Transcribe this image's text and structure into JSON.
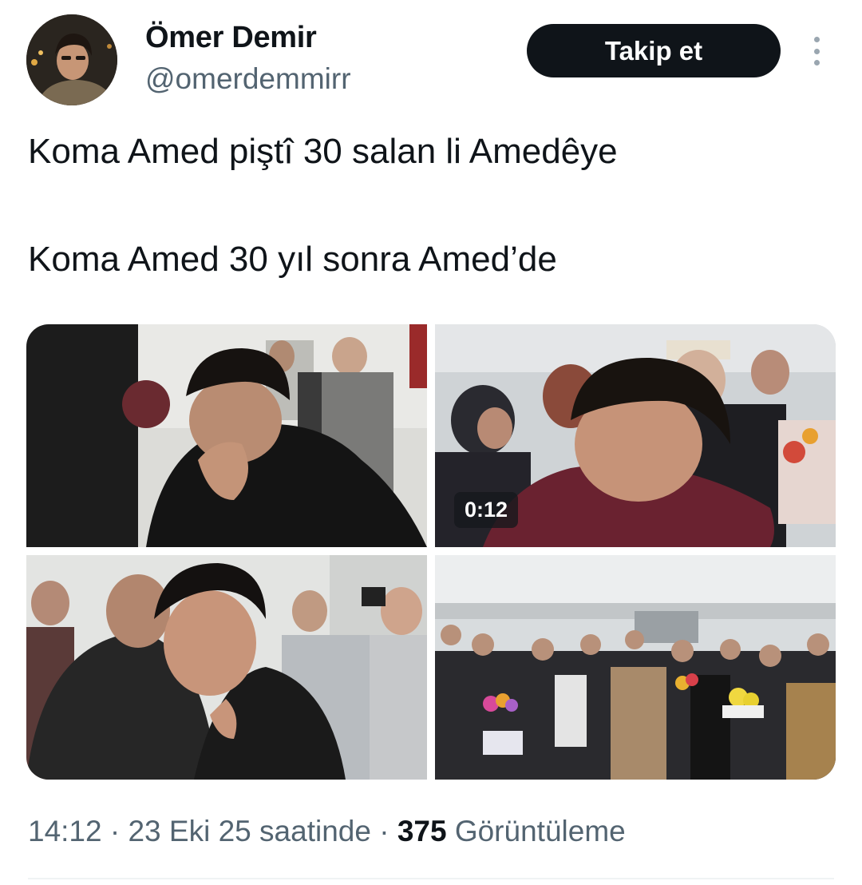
{
  "author": {
    "display_name": "Ömer Demir",
    "handle": "@omerdemmirr"
  },
  "actions": {
    "follow_label": "Takip et"
  },
  "tweet": {
    "lines": [
      "Koma Amed piştî 30 salan li Amedêye",
      "Koma Amed 30 yıl sonra Amed’de"
    ]
  },
  "media": {
    "video_duration": "0:12"
  },
  "meta": {
    "time": "14:12",
    "separator": " · ",
    "date": "23 Eki 25 saatinde",
    "views_count": "375",
    "views_label": "Görüntüleme"
  }
}
